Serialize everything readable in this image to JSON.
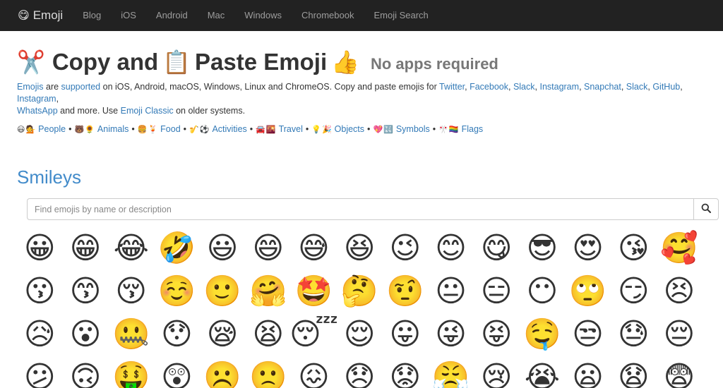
{
  "nav": {
    "brand_icon": "😋",
    "brand_label": "Emoji",
    "links": [
      "Blog",
      "iOS",
      "Android",
      "Mac",
      "Windows",
      "Chromebook",
      "Emoji Search"
    ]
  },
  "header": {
    "emoji_scissors": "✂️",
    "title_part1": "Copy and",
    "emoji_clipboard": "📋",
    "title_part2": "Paste Emoji",
    "emoji_thumb": "👍",
    "subtitle": "No apps required"
  },
  "desc": {
    "l_emojis": "Emojis",
    "t1": " are ",
    "l_supported": "supported",
    "t2": " on iOS, Android, macOS, Windows, Linux and ChromeOS. Copy and paste emojis for ",
    "l_twitter": "Twitter",
    "c1": ", ",
    "l_facebook": "Facebook",
    "c2": ", ",
    "l_slack": "Slack",
    "c3": ", ",
    "l_instagram": "Instagram",
    "c4": ", ",
    "l_snapchat": "Snapchat",
    "c5": ", ",
    "l_slack2": "Slack",
    "c6": ", ",
    "l_github": "GitHub",
    "c7": ", ",
    "l_instagram2": "Instagram",
    "c8": ",",
    "l_whatsapp": "WhatsApp",
    "t3": " and more. Use ",
    "l_classic": "Emoji Classic",
    "t4": " on older systems."
  },
  "categories": [
    {
      "e1": "😃",
      "e2": "💁",
      "label": "People"
    },
    {
      "e1": "🐻",
      "e2": "🌻",
      "label": "Animals"
    },
    {
      "e1": "🍔",
      "e2": "🍹",
      "label": "Food"
    },
    {
      "e1": "🎷",
      "e2": "⚽",
      "label": "Activities"
    },
    {
      "e1": "🚘",
      "e2": "🌇",
      "label": "Travel"
    },
    {
      "e1": "💡",
      "e2": "🎉",
      "label": "Objects"
    },
    {
      "e1": "💖",
      "e2": "🔣",
      "label": "Symbols"
    },
    {
      "e1": "🎌",
      "e2": "🏳️‍🌈",
      "label": "Flags"
    }
  ],
  "category_separator": "•",
  "section_title": "Smileys",
  "search": {
    "placeholder": "Find emojis by name or description",
    "icon": "search-icon"
  },
  "emojis": [
    "😀",
    "😁",
    "😂",
    "🤣",
    "😃",
    "😄",
    "😅",
    "😆",
    "😉",
    "😊",
    "😋",
    "😎",
    "😍",
    "😘",
    "🥰",
    "😗",
    "😙",
    "😚",
    "☺️",
    "🙂",
    "🤗",
    "🤩",
    "🤔",
    "🤨",
    "😐",
    "😑",
    "😶",
    "🙄",
    "😏",
    "😣",
    "😥",
    "😮",
    "🤐",
    "😯",
    "😪",
    "😫",
    "😴",
    "😌",
    "😛",
    "😜",
    "😝",
    "🤤",
    "😒",
    "😓",
    "😔",
    "😕",
    "🙃",
    "🤑",
    "😲",
    "☹️",
    "🙁",
    "😖",
    "😞",
    "😟",
    "😤",
    "😢",
    "😭",
    "😦",
    "😧",
    "😨"
  ]
}
